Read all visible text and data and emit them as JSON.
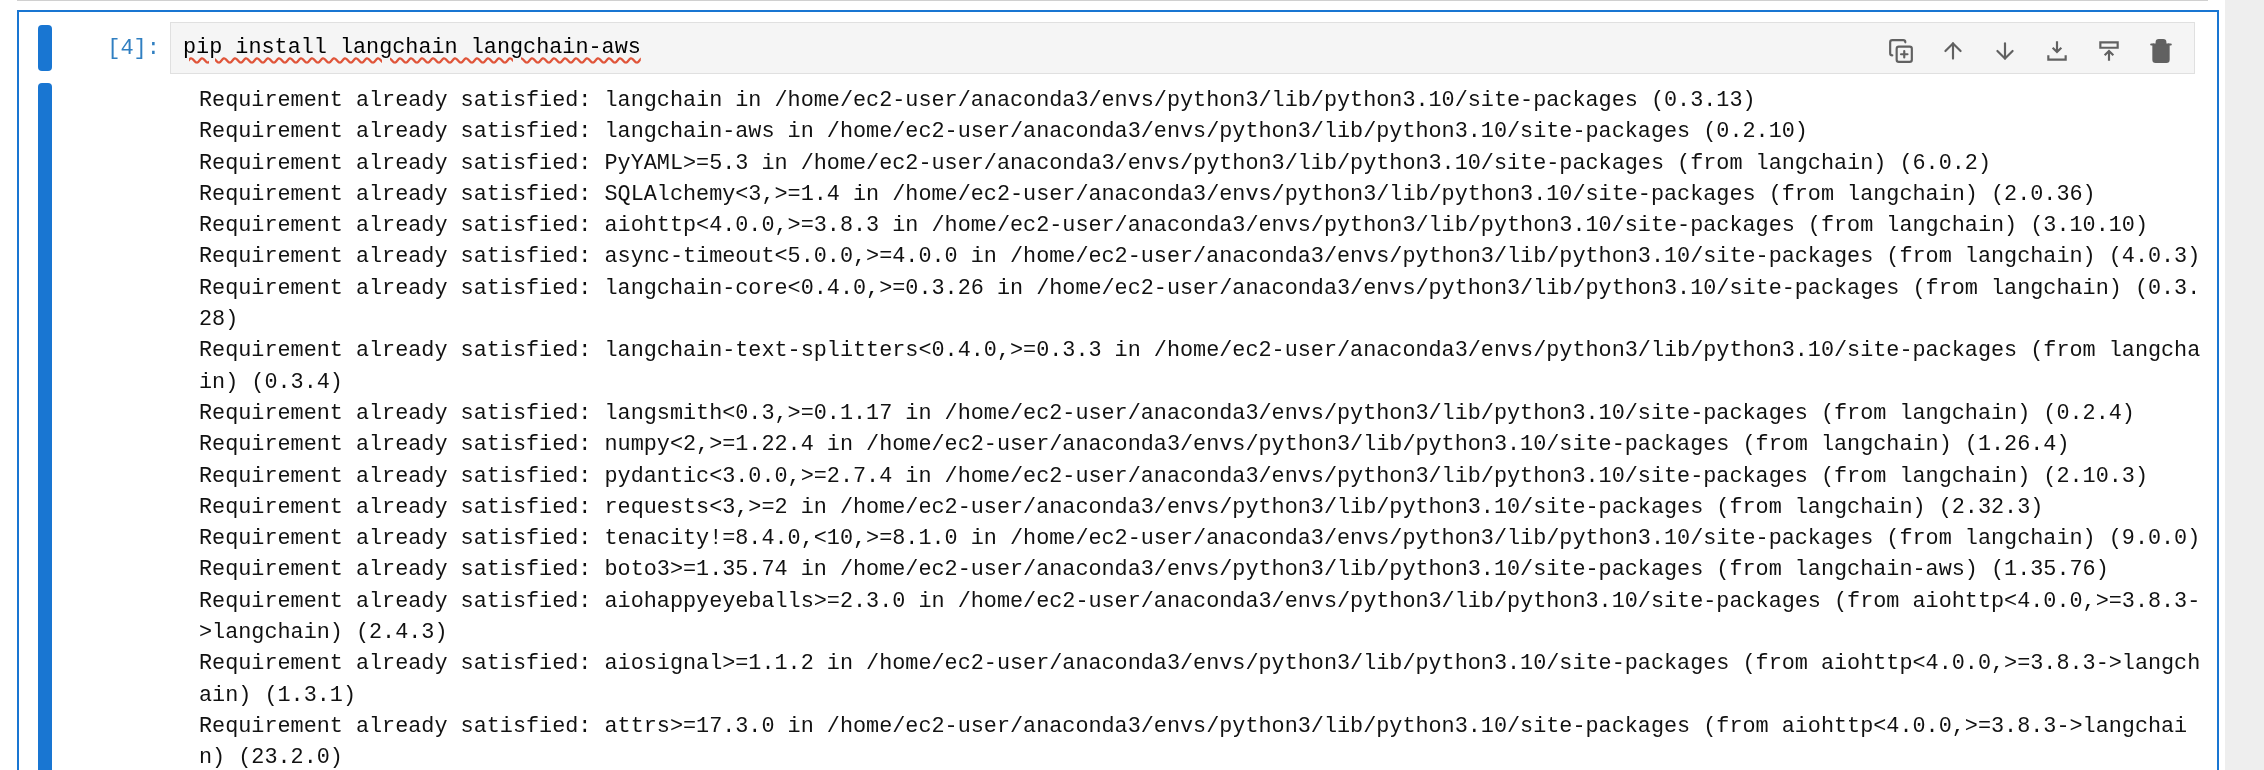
{
  "cell": {
    "prompt": "[4]:",
    "source": "pip install langchain langchain-aws",
    "output": [
      "Requirement already satisfied: langchain in /home/ec2-user/anaconda3/envs/python3/lib/python3.10/site-packages (0.3.13)",
      "Requirement already satisfied: langchain-aws in /home/ec2-user/anaconda3/envs/python3/lib/python3.10/site-packages (0.2.10)",
      "Requirement already satisfied: PyYAML>=5.3 in /home/ec2-user/anaconda3/envs/python3/lib/python3.10/site-packages (from langchain) (6.0.2)",
      "Requirement already satisfied: SQLAlchemy<3,>=1.4 in /home/ec2-user/anaconda3/envs/python3/lib/python3.10/site-packages (from langchain) (2.0.36)",
      "Requirement already satisfied: aiohttp<4.0.0,>=3.8.3 in /home/ec2-user/anaconda3/envs/python3/lib/python3.10/site-packages (from langchain) (3.10.10)",
      "Requirement already satisfied: async-timeout<5.0.0,>=4.0.0 in /home/ec2-user/anaconda3/envs/python3/lib/python3.10/site-packages (from langchain) (4.0.3)",
      "Requirement already satisfied: langchain-core<0.4.0,>=0.3.26 in /home/ec2-user/anaconda3/envs/python3/lib/python3.10/site-packages (from langchain) (0.3.",
      "28)",
      "Requirement already satisfied: langchain-text-splitters<0.4.0,>=0.3.3 in /home/ec2-user/anaconda3/envs/python3/lib/python3.10/site-packages (from langcha",
      "in) (0.3.4)",
      "Requirement already satisfied: langsmith<0.3,>=0.1.17 in /home/ec2-user/anaconda3/envs/python3/lib/python3.10/site-packages (from langchain) (0.2.4)",
      "Requirement already satisfied: numpy<2,>=1.22.4 in /home/ec2-user/anaconda3/envs/python3/lib/python3.10/site-packages (from langchain) (1.26.4)",
      "Requirement already satisfied: pydantic<3.0.0,>=2.7.4 in /home/ec2-user/anaconda3/envs/python3/lib/python3.10/site-packages (from langchain) (2.10.3)",
      "Requirement already satisfied: requests<3,>=2 in /home/ec2-user/anaconda3/envs/python3/lib/python3.10/site-packages (from langchain) (2.32.3)",
      "Requirement already satisfied: tenacity!=8.4.0,<10,>=8.1.0 in /home/ec2-user/anaconda3/envs/python3/lib/python3.10/site-packages (from langchain) (9.0.0)",
      "Requirement already satisfied: boto3>=1.35.74 in /home/ec2-user/anaconda3/envs/python3/lib/python3.10/site-packages (from langchain-aws) (1.35.76)",
      "Requirement already satisfied: aiohappyeyeballs>=2.3.0 in /home/ec2-user/anaconda3/envs/python3/lib/python3.10/site-packages (from aiohttp<4.0.0,>=3.8.3-",
      ">langchain) (2.4.3)",
      "Requirement already satisfied: aiosignal>=1.1.2 in /home/ec2-user/anaconda3/envs/python3/lib/python3.10/site-packages (from aiohttp<4.0.0,>=3.8.3->langch",
      "ain) (1.3.1)",
      "Requirement already satisfied: attrs>=17.3.0 in /home/ec2-user/anaconda3/envs/python3/lib/python3.10/site-packages (from aiohttp<4.0.0,>=3.8.3->langchai",
      "n) (23.2.0)"
    ]
  }
}
